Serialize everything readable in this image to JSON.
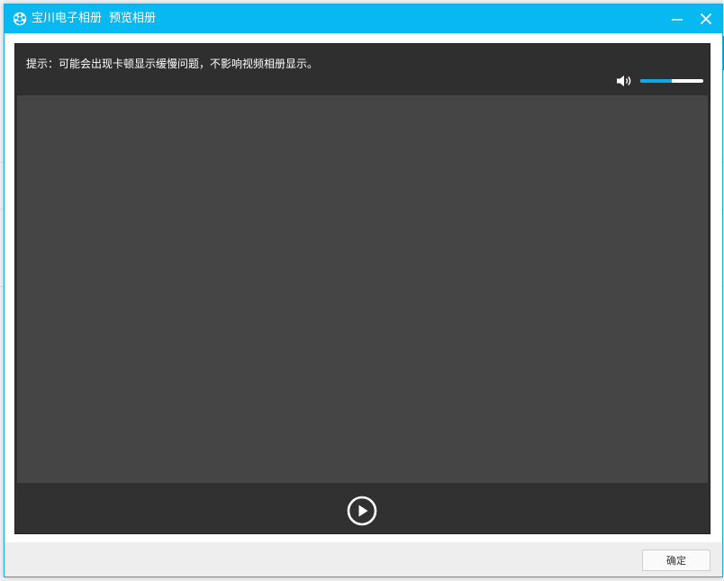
{
  "window": {
    "app_name": "宝川电子相册",
    "title": "预览相册",
    "accent_color": "#08b8f0"
  },
  "player": {
    "hint": "提示：可能会出现卡顿显示缓慢问题，不影响视频相册显示。",
    "volume_level": 0.5,
    "icons": [
      "speaker-icon",
      "play-icon"
    ]
  },
  "footer": {
    "ok_label": "确定"
  }
}
